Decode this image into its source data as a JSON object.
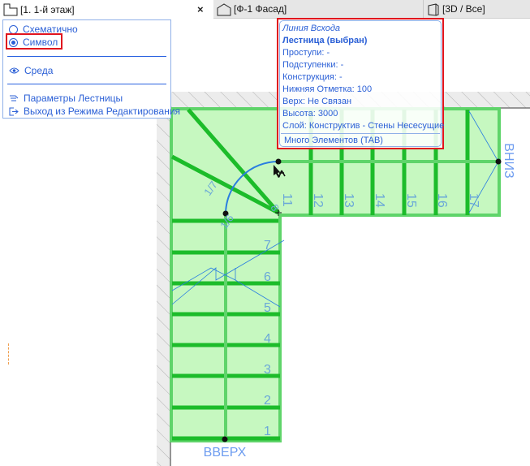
{
  "tabs": [
    {
      "label": "[1. 1-й этаж]",
      "icon": "floor-plan-icon",
      "active": true,
      "close": "×"
    },
    {
      "label": "[Ф-1 Фасад]",
      "icon": "elevation-icon"
    },
    {
      "label": "[3D / Все]",
      "icon": "3d-icon"
    }
  ],
  "menu": {
    "items": [
      {
        "label": "Схематично",
        "icon": "radio-icon",
        "selected": false
      },
      {
        "label": "Символ",
        "icon": "radio-icon",
        "selected": true
      },
      {
        "label": "Среда",
        "icon": "eye-icon"
      },
      {
        "label": "Параметры Лестницы",
        "icon": "stair-settings-icon"
      },
      {
        "label": "Выход из Режима Редактирования",
        "icon": "exit-icon"
      }
    ]
  },
  "tooltip": {
    "title": "Линия Всхода",
    "element": "Лестница (выбран)",
    "lines": [
      "Проступи: -",
      "Подступенки: -",
      "Конструкция: -",
      "Нижняя Отметка: 100",
      "Верх: Не Связан",
      "Высота: 3000",
      "Слой: Конструктив - Стены Несесущие"
    ],
    "footer": "Много Элементов (TAB)"
  },
  "stair": {
    "up_label": "ВВЕРХ",
    "down_label": "ВНИЗ",
    "flight1_numbers": [
      "1",
      "2",
      "3",
      "4",
      "5",
      "6",
      "7"
    ],
    "flight2_numbers": [
      "11",
      "12",
      "13",
      "14",
      "15",
      "16",
      "17"
    ],
    "winder_labels": [
      "1/6",
      "1/7",
      "8"
    ],
    "colors": {
      "fill": "#c6f8c0",
      "tread": "#1cbc2a",
      "annotation": "#6aa8d8",
      "walking_line": "#2a7ee0"
    }
  }
}
